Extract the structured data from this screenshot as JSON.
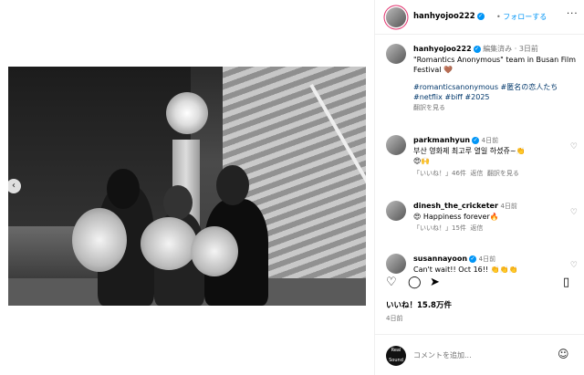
{
  "header": {
    "username": "hanhyojoo222",
    "follow_label": "フォローする",
    "separator": "•",
    "more": "···"
  },
  "post": {
    "username": "hanhyojoo222",
    "edited": "編集済み",
    "time": "3日前",
    "caption": "\"Romantics Anonymous\" team in Busan Film Festival 🤎",
    "hashtags": "#romanticsanonymous #匿名の恋人たち #netflix #biff #2025",
    "translate": "翻訳を見る"
  },
  "comments": [
    {
      "username": "parkmanhyun",
      "time": "4日前",
      "text": "부산 영화제 최고루 열일 하셨쥬~👏",
      "text2": "😍🙌",
      "likes": "46件",
      "reply": "返信",
      "translate": "翻訳を見る",
      "like_label": "「いいね！」"
    },
    {
      "username": "dinesh_the_cricketer",
      "time": "4日前",
      "text": "😍 Happiness forever🔥",
      "likes": "15件",
      "reply": "返信",
      "like_label": "「いいね！」"
    },
    {
      "username": "susannayoon",
      "time": "4日前",
      "text": "Can't wait!! Oct 16!! 👏👏👏"
    }
  ],
  "likes_count": "いいね！15.8万件",
  "posted_ago": "4日前",
  "composer": {
    "placeholder": "コメントを追加...",
    "badge": "Real Sound"
  },
  "colors": {
    "accent": "#0095f6",
    "text_secondary": "#737373",
    "hashtag": "#00376b",
    "border": "#efefef"
  },
  "icons": [
    "heart-icon",
    "comment-icon",
    "share-icon",
    "bookmark-icon",
    "emoji-icon",
    "verified-icon",
    "prev-arrow-icon"
  ]
}
